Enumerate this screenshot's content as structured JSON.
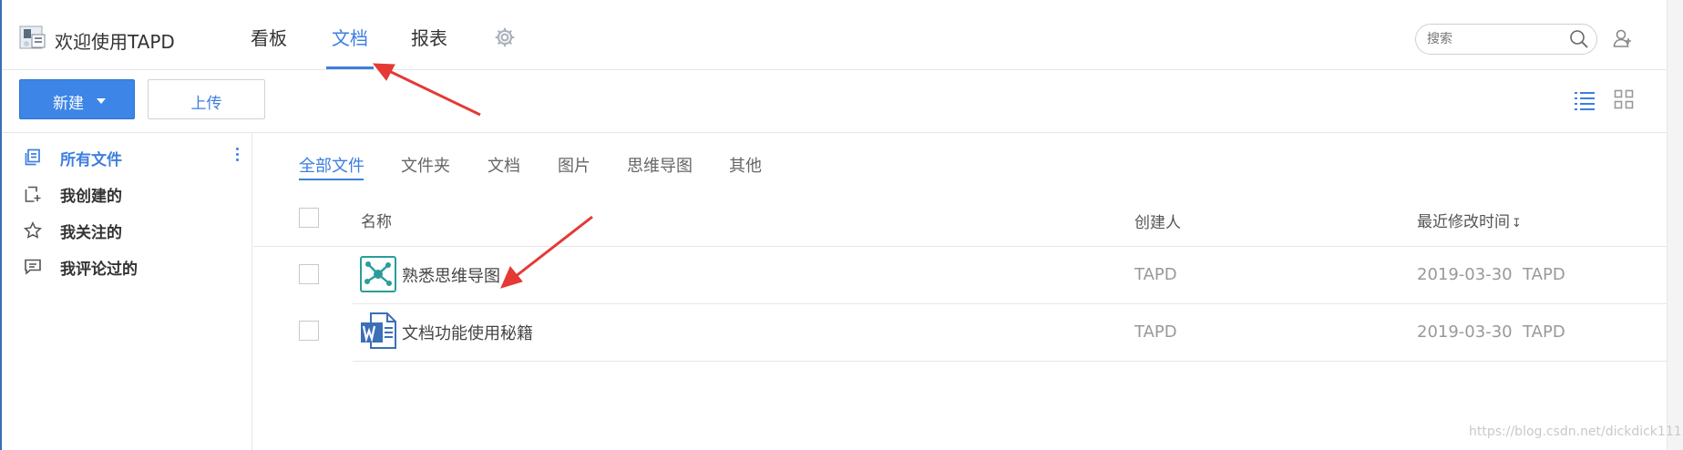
{
  "app": {
    "title": "欢迎使用TAPD"
  },
  "nav": {
    "tabs": [
      {
        "label": "看板"
      },
      {
        "label": "文档",
        "active": true
      },
      {
        "label": "报表"
      }
    ],
    "settings_icon": "gear-icon"
  },
  "search": {
    "placeholder": "搜索",
    "icon": "search-icon"
  },
  "toolbar": {
    "new_label": "新建",
    "upload_label": "上传"
  },
  "sidebar": {
    "items": [
      {
        "label": "所有文件",
        "icon": "files-icon",
        "active": true
      },
      {
        "label": "我创建的",
        "icon": "file-add-icon"
      },
      {
        "label": "我关注的",
        "icon": "star-icon"
      },
      {
        "label": "我评论过的",
        "icon": "comment-icon"
      }
    ]
  },
  "filters": [
    "全部文件",
    "文件夹",
    "文档",
    "图片",
    "思维导图",
    "其他"
  ],
  "table": {
    "columns": {
      "name": "名称",
      "creator": "创建人",
      "modified": "最近修改时间"
    },
    "rows": [
      {
        "name": "熟悉思维导图",
        "type": "mindmap-icon",
        "creator": "TAPD",
        "modified": "2019-03-30  TAPD"
      },
      {
        "name": "文档功能使用秘籍",
        "type": "word-doc-icon",
        "creator": "TAPD",
        "modified": "2019-03-30  TAPD"
      }
    ]
  },
  "watermark": "https://blog.csdn.net/dickdick111",
  "colors": {
    "accent": "#3d7ee0",
    "button_primary": "#3d85e6",
    "annotation_arrow": "#e53935",
    "mindmap_icon": "#2a9d9b",
    "word_icon": "#3b6fb8"
  }
}
